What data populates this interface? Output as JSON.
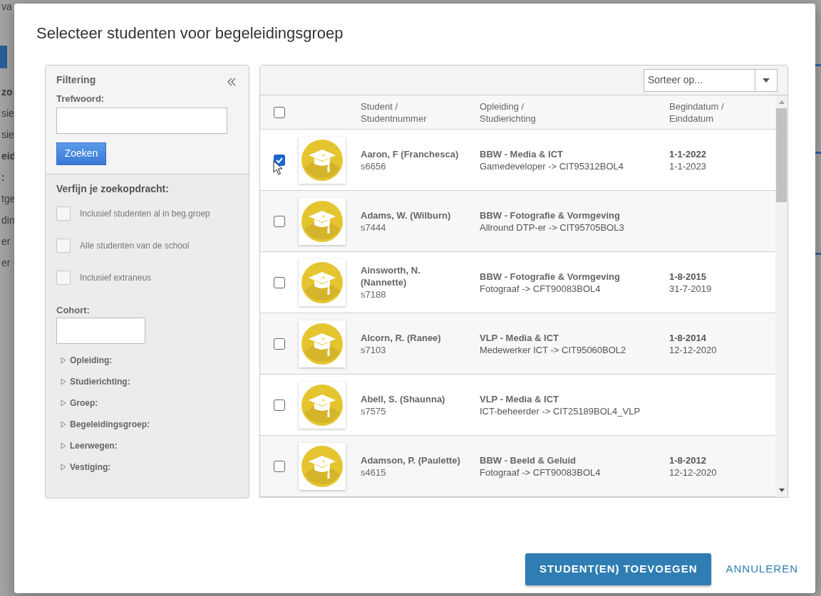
{
  "background": {
    "fragments": [
      {
        "text": "va",
        "bold": false
      },
      {
        "text": "zo",
        "bold": true
      },
      {
        "text": "sie",
        "bold": false
      },
      {
        "text": "sie",
        "bold": false
      },
      {
        "text": "eid",
        "bold": true
      },
      {
        "text": ":",
        "bold": true
      },
      {
        "text": "tge",
        "bold": false
      },
      {
        "text": "din",
        "bold": false
      },
      {
        "text": "er",
        "bold": false
      },
      {
        "text": "er",
        "bold": false
      }
    ]
  },
  "dialog": {
    "title": "Selecteer studenten voor begeleidingsgroep"
  },
  "filter": {
    "title": "Filtering",
    "keyword_label": "Trefwoord:",
    "search_button": "Zoeken",
    "refine_title": "Verfijn je zoekopdracht:",
    "options": [
      {
        "label": "Inclusief studenten al in beg.groep",
        "checked": false
      },
      {
        "label": "Alle studenten van de school",
        "checked": false
      },
      {
        "label": "Inclusief extraneus",
        "checked": false
      }
    ],
    "cohort_label": "Cohort:",
    "sections": [
      {
        "label": "Opleiding:",
        "expanded": false
      },
      {
        "label": "Studierichting:",
        "expanded": false
      },
      {
        "label": "Groep:",
        "expanded": false
      },
      {
        "label": "Begeleidingsgroep:",
        "expanded": false
      },
      {
        "label": "Leerwegen:",
        "expanded": false
      },
      {
        "label": "Vestiging:",
        "expanded": false
      }
    ]
  },
  "table": {
    "sort_placeholder": "Sorteer op...",
    "select_all": {
      "checked": false
    },
    "columns": [
      "Student / Studentnummer",
      "Opleiding / Studierichting",
      "Begindatum / Einddatum"
    ],
    "rows": [
      {
        "name": "Aaron, F (Franchesca)",
        "number": "s6656",
        "opleiding": "BBW - Media & ICT",
        "studierichting": "Gamedeveloper -> CIT95312BOL4",
        "begindatum": "1-1-2022",
        "einddatum": "1-1-2023",
        "selected": true
      },
      {
        "name": "Adams, W. (Wilburn)",
        "number": "s7444",
        "opleiding": "BBW - Fotografie & Vormgeving",
        "studierichting": "Allround DTP-er -> CIT95705BOL3",
        "selected": false
      },
      {
        "name": "Ainsworth, N. (Nannette)",
        "number": "s7188",
        "opleiding": "BBW - Fotografie & Vormgeving",
        "studierichting": "Fotograaf -> CFT90083BOL4",
        "begindatum": "1-8-2015",
        "einddatum": "31-7-2019",
        "selected": false
      },
      {
        "name": "Alcorn, R. (Ranee)",
        "number": "s7103",
        "opleiding": "VLP - Media & ICT",
        "studierichting": "Medewerker ICT -> CIT95060BOL2",
        "begindatum": "1-8-2014",
        "einddatum": "12-12-2020",
        "selected": false
      },
      {
        "name": "Abell, S. (Shaunna)",
        "number": "s7575",
        "opleiding": "VLP - Media & ICT",
        "studierichting": "ICT-beheerder -> CIT25189BOL4_VLP",
        "selected": false
      },
      {
        "name": "Adamson, P. (Paulette)",
        "number": "s4615",
        "opleiding": "BBW - Beeld & Geluid",
        "studierichting": "Fotograaf -> CFT90083BOL4",
        "begindatum": "1-8-2012",
        "einddatum": "12-12-2020",
        "selected": false
      }
    ]
  },
  "footer": {
    "add_button": "STUDENT(EN) TOEVOEGEN",
    "cancel_button": "ANNULEREN"
  }
}
